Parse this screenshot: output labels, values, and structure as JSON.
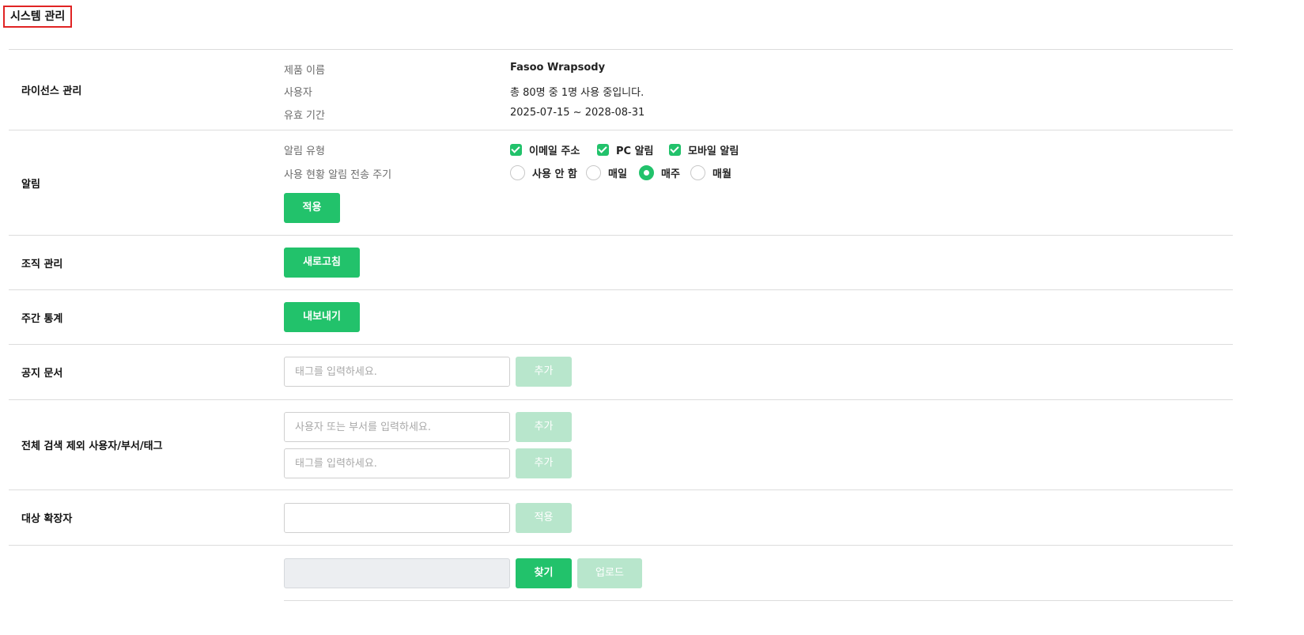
{
  "page": {
    "title": "시스템 관리"
  },
  "license": {
    "label": "라이선스 관리",
    "product_label": "제품 이름",
    "product_value": "Fasoo Wrapsody",
    "user_label": "사용자",
    "user_value": "총 80명 중 1명 사용 중입니다.",
    "period_label": "유효 기간",
    "period_value": "2025-07-15 ~ 2028-08-31"
  },
  "notification": {
    "label": "알림",
    "type_label": "알림 유형",
    "types": [
      {
        "label": "이메일 주소",
        "checked": true
      },
      {
        "label": "PC 알림",
        "checked": true
      },
      {
        "label": "모바일 알림",
        "checked": true
      }
    ],
    "cycle_label": "사용 현황 알림 전송 주기",
    "cycles": [
      {
        "label": "사용 안 함",
        "selected": false
      },
      {
        "label": "매일",
        "selected": false
      },
      {
        "label": "매주",
        "selected": true
      },
      {
        "label": "매월",
        "selected": false
      }
    ],
    "apply_label": "적용"
  },
  "org": {
    "label": "조직 관리",
    "refresh_label": "새로고침"
  },
  "weekly": {
    "label": "주간 통계",
    "export_label": "내보내기"
  },
  "notice": {
    "label": "공지 문서",
    "placeholder": "태그를 입력하세요.",
    "add_label": "추가"
  },
  "exclude": {
    "label": "전체 검색 제외 사용자/부서/태그",
    "user_placeholder": "사용자 또는 부서를 입력하세요.",
    "tag_placeholder": "태그를 입력하세요.",
    "add_label": "추가"
  },
  "ext": {
    "label": "대상 확장자",
    "apply_label": "적용"
  },
  "upload": {
    "find_label": "찾기",
    "upload_label": "업로드"
  },
  "colors": {
    "accent": "#22c26b",
    "accent_disabled": "#b8e6cc",
    "title_border": "#e02424"
  }
}
